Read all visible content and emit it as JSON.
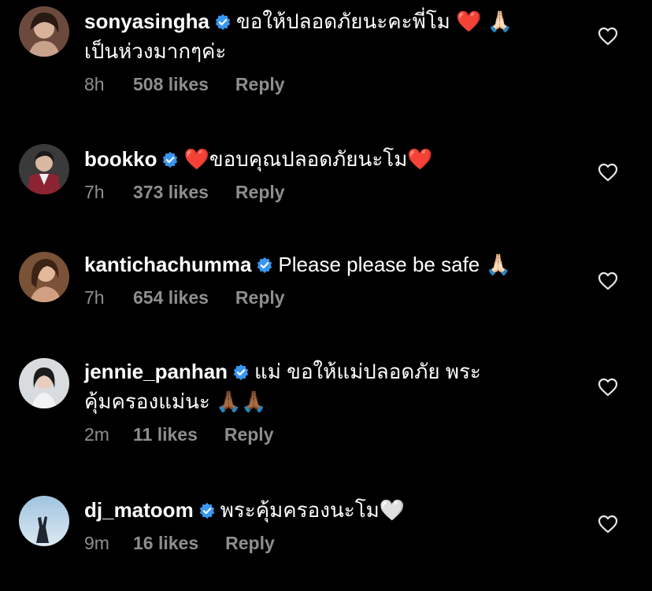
{
  "comments": [
    {
      "username": "sonyasingha",
      "text_line1": "ขอให้ปลอดภัยนะคะพี่โม ❤️ 🙏🏻",
      "text_line2": "เป็นห่วงมากๆค่ะ",
      "time": "8h",
      "likes": "508 likes",
      "reply": "Reply",
      "avatar_icon": "profile-photo"
    },
    {
      "username": "bookko",
      "text_line1": "❤️ขอบคุณปลอดภัยนะโม❤️",
      "text_line2": "",
      "time": "7h",
      "likes": "373 likes",
      "reply": "Reply",
      "avatar_icon": "profile-photo"
    },
    {
      "username": "kantichachumma",
      "text_line1": "Please please be safe 🙏🏻",
      "text_line2": "",
      "time": "7h",
      "likes": "654 likes",
      "reply": "Reply",
      "avatar_icon": "profile-photo"
    },
    {
      "username": "jennie_panhan",
      "text_line1": "แม่ ขอให้แม่ปลอดภัย พระ",
      "text_line2": "คุ้มครองแม่นะ 🙏🏾🙏🏾",
      "time": "2m",
      "likes": "11 likes",
      "reply": "Reply",
      "avatar_icon": "profile-photo"
    },
    {
      "username": "dj_matoom",
      "text_line1": "พระคุ้มครองนะโม🤍",
      "text_line2": "",
      "time": "9m",
      "likes": "16 likes",
      "reply": "Reply",
      "avatar_icon": "profile-photo"
    }
  ],
  "colors": {
    "background": "#000000",
    "meta": "#8e8e8e",
    "verified": "#3897f0"
  },
  "icons": {
    "verified": "verified-badge-icon",
    "like": "heart-outline-icon"
  }
}
